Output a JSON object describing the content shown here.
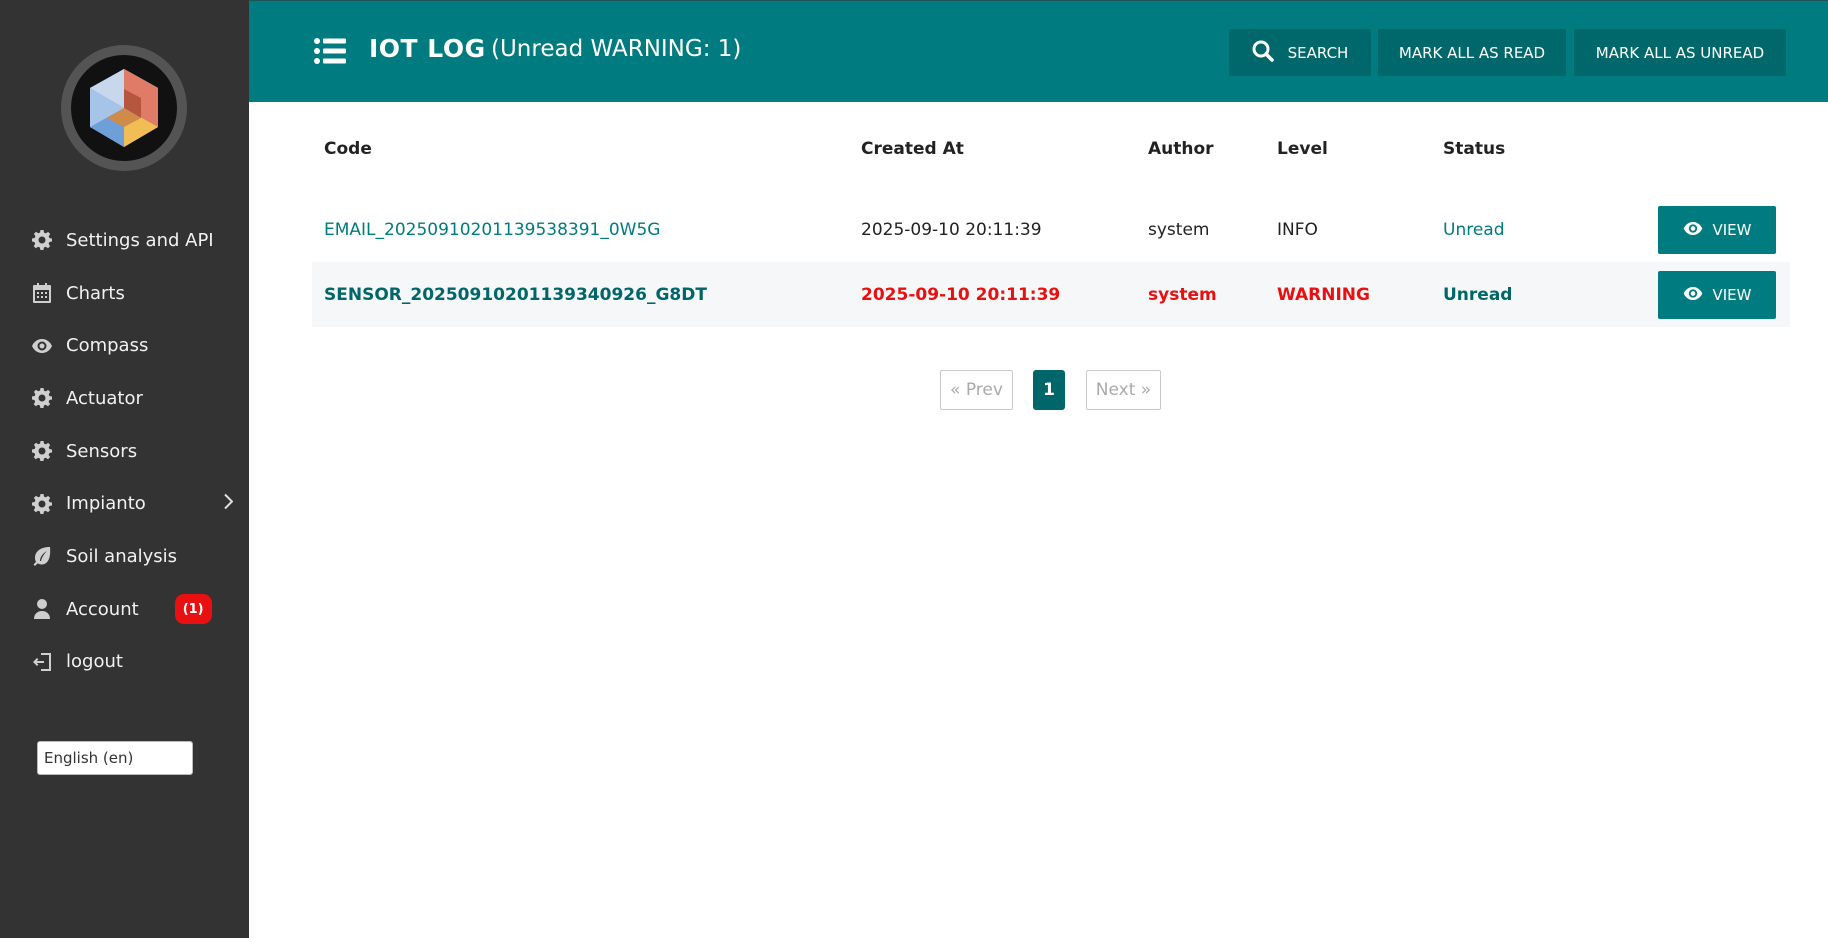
{
  "header": {
    "title": "IOT LOG",
    "subtitle": "(Unread WARNING: 1)",
    "search_label": "SEARCH",
    "mark_read_label": "MARK ALL AS READ",
    "mark_unread_label": "MARK ALL AS UNREAD"
  },
  "sidebar": {
    "items": [
      {
        "label": "Settings and API",
        "icon": "gear-icon"
      },
      {
        "label": "Charts",
        "icon": "calendar-icon"
      },
      {
        "label": "Compass",
        "icon": "eye-icon"
      },
      {
        "label": "Actuator",
        "icon": "gear-icon"
      },
      {
        "label": "Sensors",
        "icon": "gear-icon"
      },
      {
        "label": "Impianto",
        "icon": "gear-icon"
      },
      {
        "label": "Soil analysis",
        "icon": "leaf-icon"
      },
      {
        "label": "Account",
        "icon": "user-icon",
        "badge": "(1)"
      },
      {
        "label": "logout",
        "icon": "logout-icon"
      }
    ],
    "language": "English (en)"
  },
  "table": {
    "columns": [
      "Code",
      "Created At",
      "Author",
      "Level",
      "Status"
    ],
    "rows": [
      {
        "code": "EMAIL_20250910201139538391_0W5G",
        "created_at": "2025-09-10 20:11:39",
        "author": "system",
        "level": "INFO",
        "status": "Unread",
        "action": "VIEW"
      },
      {
        "code": "SENSOR_20250910201139340926_G8DT",
        "created_at": "2025-09-10 20:11:39",
        "author": "system",
        "level": "WARNING",
        "status": "Unread",
        "action": "VIEW"
      }
    ]
  },
  "pagination": {
    "prev": "« Prev",
    "current": "1",
    "next": "Next »"
  },
  "colors": {
    "primary": "#007b7f",
    "sidebar": "#333333",
    "warning": "#e81010"
  }
}
